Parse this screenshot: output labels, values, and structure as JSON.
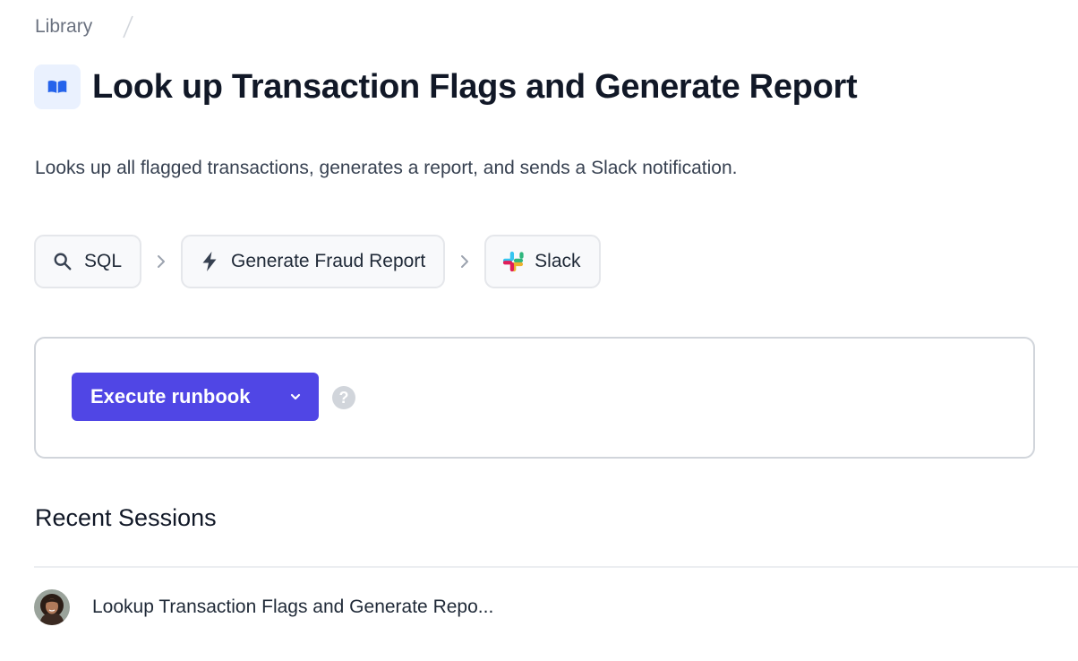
{
  "breadcrumb": {
    "items": [
      "Library"
    ]
  },
  "header": {
    "icon": "book-open-icon",
    "title": "Look up Transaction Flags and Generate Report"
  },
  "description": "Looks up all flagged transactions, generates a report, and sends a Slack notification.",
  "steps": [
    {
      "label": "SQL",
      "icon": "search-icon"
    },
    {
      "label": "Generate Fraud Report",
      "icon": "lightning-bolt-icon"
    },
    {
      "label": "Slack",
      "icon": "slack-logo-icon"
    }
  ],
  "execute": {
    "button_label": "Execute runbook",
    "help_glyph": "?"
  },
  "recent_sessions": {
    "title": "Recent Sessions",
    "items": [
      {
        "name": "Lookup Transaction Flags and Generate Repo..."
      }
    ]
  },
  "colors": {
    "primary_button": "#5046e5",
    "icon_badge_bg": "#eaf1fe",
    "icon_blue": "#2563eb"
  }
}
